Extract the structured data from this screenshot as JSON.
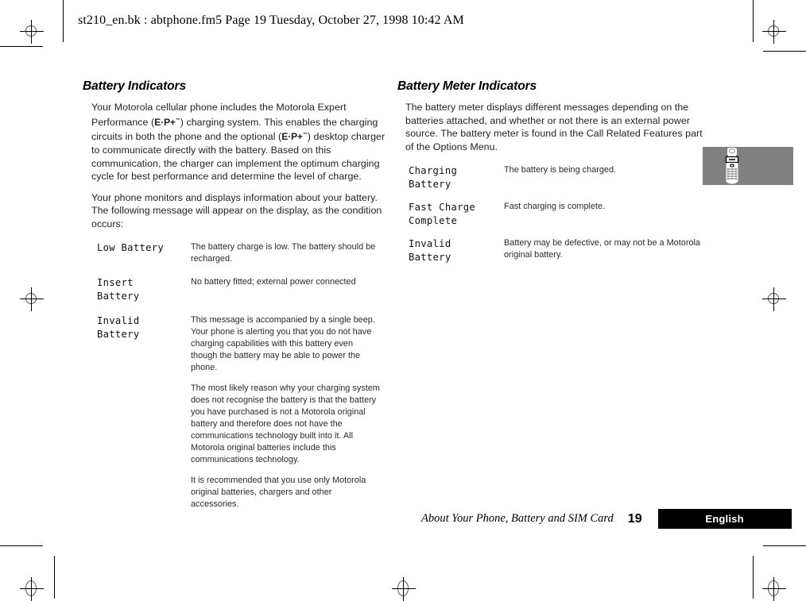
{
  "header": {
    "file_line": "st210_en.bk : abtphone.fm5  Page 19  Tuesday, October 27, 1998  10:42 AM"
  },
  "left_column": {
    "title": "Battery Indicators",
    "paragraphs": [
      {
        "part1": "Your Motorola cellular phone includes the Motorola Expert Performance (",
        "logo1": "E·P+",
        "logo1_tm": "™",
        "part2": ") charging system. This enables the charging circuits in both the phone and the optional (",
        "logo2": "E·P+",
        "logo2_tm": "™",
        "part3": ") desktop charger to communicate directly with the battery. Based on this communication, the charger can implement the optimum charging cycle for best performance and determine the level of charge."
      },
      {
        "text": "Your phone monitors and displays information about your battery. The following message will appear on the display, as the condition occurs:"
      }
    ],
    "rows": [
      {
        "term": "Low Battery",
        "desc": [
          "The battery charge is low. The battery should be recharged."
        ]
      },
      {
        "term": "Insert\nBattery",
        "desc": [
          "No battery fitted; external power connected"
        ]
      },
      {
        "term": "Invalid\nBattery",
        "desc": [
          "This message is accompanied by a single beep. Your phone is alerting you that you do not have charging capabilities with this battery even though the battery may be able to power the phone.",
          "The most likely reason why your charging system does not recognise the battery is that the battery you have purchased is not a Motorola original battery and therefore does not have the communications technology built into it. All Motorola original batteries include this communications technology.",
          "It is recommended that you use only Motorola original batteries, chargers and other accessories."
        ]
      }
    ]
  },
  "right_column": {
    "title": "Battery Meter Indicators",
    "intro": "The battery meter displays different messages depending on the batteries attached, and whether or not there is an external power source. The battery meter is found in the Call Related Features part of the Options Menu.",
    "rows": [
      {
        "term": "Charging\nBattery",
        "desc": [
          "The battery is being charged."
        ]
      },
      {
        "term": "Fast Charge\nComplete",
        "desc": [
          "Fast charging is complete."
        ]
      },
      {
        "term": "Invalid\nBattery",
        "desc": [
          "Battery may be defective, or may not be a Motorola original battery."
        ]
      }
    ]
  },
  "illustration": {
    "label": "phone-illustration",
    "background_color": "#808080",
    "device_color": "#ffffff"
  },
  "footer": {
    "chapter_title": "About Your Phone, Battery and SIM Card",
    "page_number": "19",
    "language": "English"
  }
}
